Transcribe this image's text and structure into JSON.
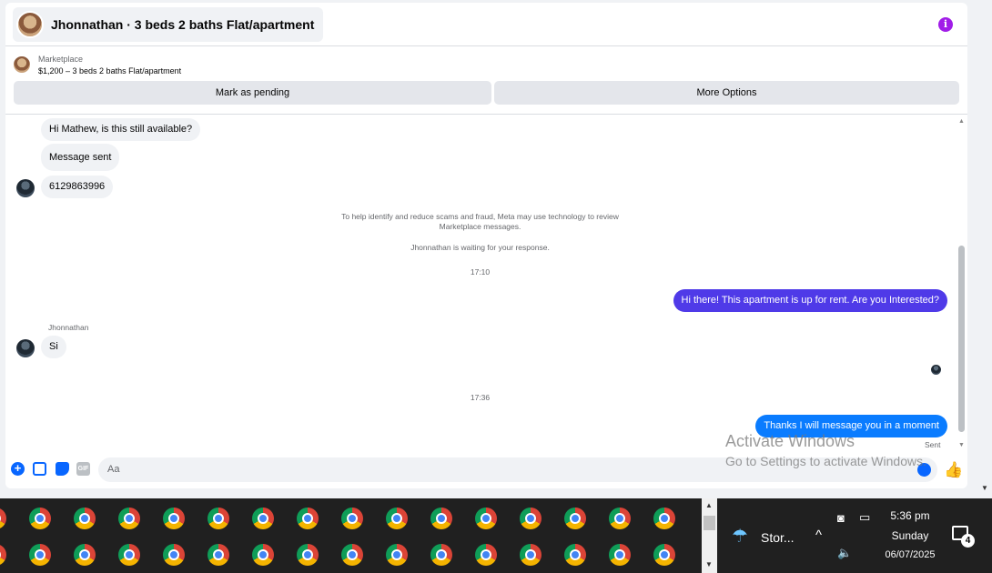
{
  "header": {
    "title": "Jhonnathan · 3 beds 2 baths Flat/apartment",
    "info_icon": "i"
  },
  "listing": {
    "source": "Marketplace",
    "summary": "$1,200 – 3 beds 2 baths Flat/apartment",
    "mark_pending_label": "Mark as pending",
    "more_options_label": "More Options"
  },
  "thread": {
    "messages_in_top": [
      "Hi Mathew, is this still available?",
      "Message sent",
      "6129863996"
    ],
    "notice_line1": "To help identify and reduce scams and fraud, Meta may use technology to review",
    "notice_line2": "Marketplace messages.",
    "waiting_text": "Jhonnathan is waiting for your response.",
    "time1": "17:10",
    "out_message1": "Hi there! This apartment is up for rent. Are you Interested?",
    "sender_name": "Jhonnathan",
    "in_message2": "Si",
    "time2": "17:36",
    "out_message2": "Thanks I will message you in a moment",
    "sent_status": "Sent"
  },
  "composer": {
    "placeholder": "Aa",
    "gif_label": "GIF"
  },
  "watermark": {
    "line1": "Activate Windows",
    "line2": "Go to Settings to activate Windows."
  },
  "taskbar": {
    "weather": "Stor...",
    "time": "5:36 pm",
    "day": "Sunday",
    "date": "06/07/2025",
    "notification_count": "4"
  },
  "colors": {
    "outgoing_purple": "#4f3ae8",
    "outgoing_blue": "#0a7cff",
    "accent": "#0866ff",
    "info": "#a11de8"
  }
}
